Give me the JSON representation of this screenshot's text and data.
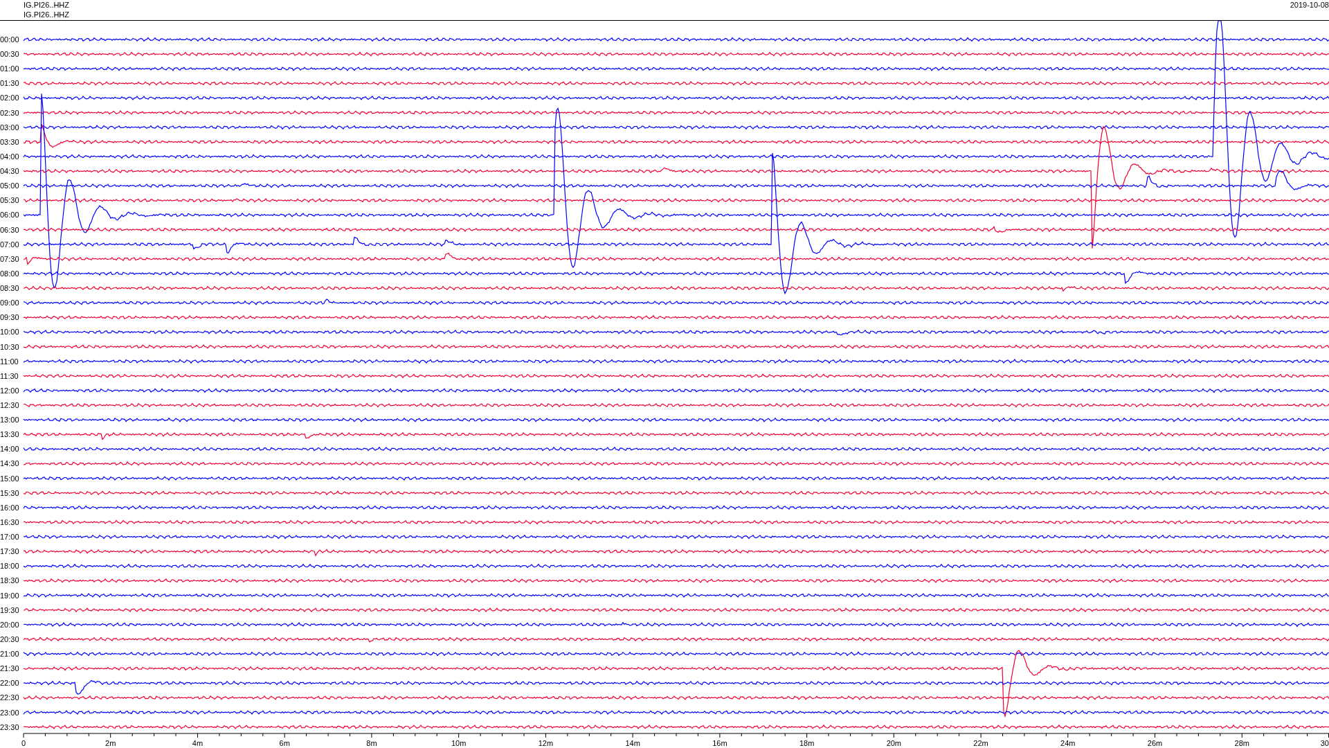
{
  "header": {
    "station_lines": [
      "IG.PI26..HHZ",
      "IG.PI26..HHZ"
    ],
    "date": "2019-10-08"
  },
  "rows": [
    {
      "label": "00:00",
      "color": "#0000ff"
    },
    {
      "label": "00:30",
      "color": "#f00033"
    },
    {
      "label": "01:00",
      "color": "#0000ff"
    },
    {
      "label": "01:30",
      "color": "#f00033"
    },
    {
      "label": "02:00",
      "color": "#0000ff"
    },
    {
      "label": "02:30",
      "color": "#f00033"
    },
    {
      "label": "03:00",
      "color": "#0000ff"
    },
    {
      "label": "03:30",
      "color": "#f00033"
    },
    {
      "label": "04:00",
      "color": "#0000ff"
    },
    {
      "label": "04:30",
      "color": "#f00033"
    },
    {
      "label": "05:00",
      "color": "#0000ff"
    },
    {
      "label": "05:30",
      "color": "#f00033"
    },
    {
      "label": "06:00",
      "color": "#0000ff"
    },
    {
      "label": "06:30",
      "color": "#f00033"
    },
    {
      "label": "07:00",
      "color": "#0000ff"
    },
    {
      "label": "07:30",
      "color": "#f00033"
    },
    {
      "label": "08:00",
      "color": "#0000ff"
    },
    {
      "label": "08:30",
      "color": "#f00033"
    },
    {
      "label": "09:00",
      "color": "#0000ff"
    },
    {
      "label": "09:30",
      "color": "#f00033"
    },
    {
      "label": "10:00",
      "color": "#0000ff"
    },
    {
      "label": "10:30",
      "color": "#f00033"
    },
    {
      "label": "11:00",
      "color": "#0000ff"
    },
    {
      "label": "11:30",
      "color": "#f00033"
    },
    {
      "label": "12:00",
      "color": "#0000ff"
    },
    {
      "label": "12:30",
      "color": "#f00033"
    },
    {
      "label": "13:00",
      "color": "#0000ff"
    },
    {
      "label": "13:30",
      "color": "#f00033"
    },
    {
      "label": "14:00",
      "color": "#0000ff"
    },
    {
      "label": "14:30",
      "color": "#f00033"
    },
    {
      "label": "15:00",
      "color": "#0000ff"
    },
    {
      "label": "15:30",
      "color": "#f00033"
    },
    {
      "label": "16:00",
      "color": "#0000ff"
    },
    {
      "label": "16:30",
      "color": "#f00033"
    },
    {
      "label": "17:00",
      "color": "#0000ff"
    },
    {
      "label": "17:30",
      "color": "#f00033"
    },
    {
      "label": "18:00",
      "color": "#0000ff"
    },
    {
      "label": "18:30",
      "color": "#f00033"
    },
    {
      "label": "19:00",
      "color": "#0000ff"
    },
    {
      "label": "19:30",
      "color": "#f00033"
    },
    {
      "label": "20:00",
      "color": "#0000ff"
    },
    {
      "label": "20:30",
      "color": "#f00033"
    },
    {
      "label": "21:00",
      "color": "#0000ff"
    },
    {
      "label": "21:30",
      "color": "#f00033"
    },
    {
      "label": "22:00",
      "color": "#0000ff"
    },
    {
      "label": "22:30",
      "color": "#f00033"
    },
    {
      "label": "23:00",
      "color": "#0000ff"
    },
    {
      "label": "23:30",
      "color": "#f00033"
    }
  ],
  "x_axis": {
    "labels": [
      "0",
      "2m",
      "4m",
      "6m",
      "8m",
      "10m",
      "12m",
      "14m",
      "16m",
      "18m",
      "20m",
      "22m",
      "24m",
      "26m",
      "28m",
      "30"
    ]
  }
}
